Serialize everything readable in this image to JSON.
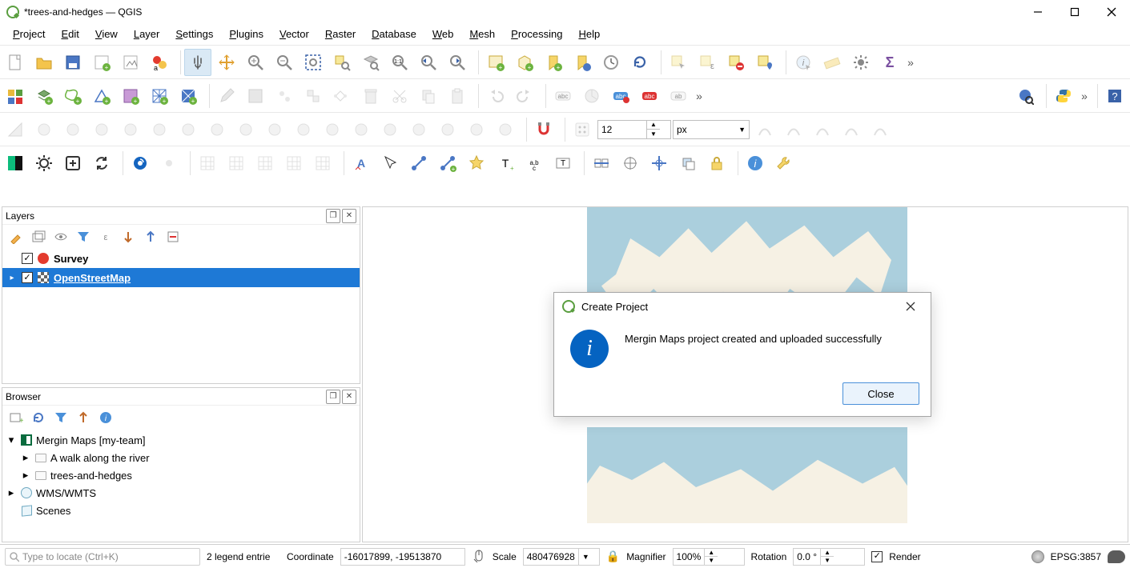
{
  "window": {
    "title": "*trees-and-hedges — QGIS"
  },
  "menu": {
    "project": "Project",
    "edit": "Edit",
    "view": "View",
    "layer": "Layer",
    "settings": "Settings",
    "plugins": "Plugins",
    "vector": "Vector",
    "raster": "Raster",
    "database": "Database",
    "web": "Web",
    "mesh": "Mesh",
    "processing": "Processing",
    "help": "Help"
  },
  "snap": {
    "value": "12",
    "unit": "px"
  },
  "layers_panel": {
    "title": "Layers",
    "items": [
      {
        "name": "Survey",
        "checked": true,
        "symbol": "red",
        "bold": true,
        "selected": false,
        "link": false
      },
      {
        "name": "OpenStreetMap",
        "checked": true,
        "symbol": "grid",
        "bold": true,
        "selected": true,
        "link": true
      }
    ]
  },
  "browser_panel": {
    "title": "Browser",
    "items": [
      {
        "label": "Mergin Maps [my-team]",
        "icon": "mm",
        "indent": 0,
        "expander": "▾"
      },
      {
        "label": "A walk along the river",
        "icon": "folder",
        "indent": 1,
        "expander": "▸"
      },
      {
        "label": "trees-and-hedges",
        "icon": "folder",
        "indent": 1,
        "expander": "▸"
      },
      {
        "label": "WMS/WMTS",
        "icon": "globe",
        "indent": 0,
        "expander": "▸"
      },
      {
        "label": "Scenes",
        "icon": "cube",
        "indent": 0,
        "expander": ""
      }
    ]
  },
  "dialog": {
    "title": "Create Project",
    "message": "Mergin Maps project created and uploaded successfully",
    "close_label": "Close"
  },
  "status": {
    "locate_placeholder": "Type to locate (Ctrl+K)",
    "legend": "2 legend entrie",
    "coord_label": "Coordinate",
    "coord_value": "-16017899, -19513870",
    "scale_label": "Scale",
    "scale_value": "480476928",
    "magnifier_label": "Magnifier",
    "magnifier_value": "100%",
    "rotation_label": "Rotation",
    "rotation_value": "0.0 °",
    "render_label": "Render",
    "crs": "EPSG:3857"
  },
  "colors": {
    "selection": "#1e79d6",
    "accent_green": "#5a9e3f",
    "info_blue": "#0563c1",
    "ocean": "#abcfdd",
    "land": "#f6f1e4"
  }
}
